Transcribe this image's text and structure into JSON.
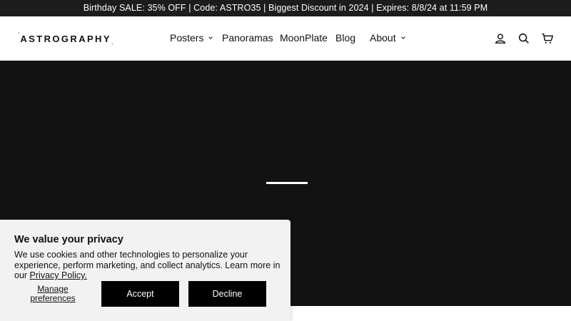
{
  "announcement": {
    "text": "Birthday SALE: 35% OFF | Code: ASTRO35 | Biggest Discount in 2024 | Expires: 8/8/24 at 11:59 PM"
  },
  "header": {
    "logo_text": "ASTROGRAPHY",
    "logo_accent_color": "#e8a23a",
    "nav": [
      {
        "label": "Posters",
        "has_dropdown": true
      },
      {
        "label": "Panoramas",
        "has_dropdown": false
      },
      {
        "label": "MoonPlate",
        "has_dropdown": false
      },
      {
        "label": "Blog",
        "has_dropdown": false
      },
      {
        "label": "About",
        "has_dropdown": true
      }
    ],
    "icons": [
      "account-icon",
      "search-icon",
      "cart-icon"
    ]
  },
  "hero": {
    "background_color": "#121212",
    "loading": true
  },
  "cookie_banner": {
    "title": "We value your privacy",
    "body": "We use cookies and other technologies to personalize your experience, perform marketing, and collect analytics. Learn more in our ",
    "link_text": "Privacy Policy.",
    "manage_label": "Manage preferences",
    "accept_label": "Accept",
    "decline_label": "Decline"
  }
}
